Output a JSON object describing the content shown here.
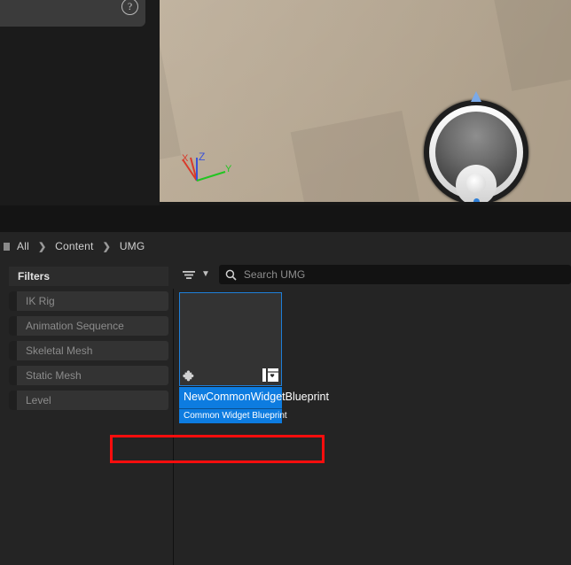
{
  "window": {
    "help_icon": "help-circle-icon"
  },
  "viewport": {
    "gizmo": {
      "x_label": "X",
      "y_label": "Y",
      "z_label": "Z",
      "x_color": "#d93a2b",
      "y_color": "#22c522",
      "z_color": "#3a52d9"
    }
  },
  "breadcrumb": {
    "items": [
      "All",
      "Content",
      "UMG"
    ],
    "separator": "❯"
  },
  "filters": {
    "title": "Filters",
    "items": [
      {
        "label": "IK Rig"
      },
      {
        "label": "Animation Sequence"
      },
      {
        "label": "Skeletal Mesh"
      },
      {
        "label": "Static Mesh"
      },
      {
        "label": "Level"
      }
    ]
  },
  "toolbar": {
    "filter_icon": "filter-icon",
    "dropdown_icon": "chevron-down-icon",
    "search_icon": "search-icon",
    "search_placeholder": "Search UMG",
    "search_value": ""
  },
  "assets": [
    {
      "name": "NewCommonWidgetBlueprint",
      "type": "Common Widget Blueprint",
      "selected": true,
      "blueprint_icon": "puzzle-piece-icon",
      "widget_icon": "umg-widget-icon"
    }
  ],
  "annotation": {
    "color": "#fc0d0d",
    "target": "asset-type-label"
  },
  "colors": {
    "accent_blue": "#0d7ce0",
    "selection_border": "#1f7fd8",
    "panel_bg": "#242424",
    "field_bg": "#121212",
    "annotation_red": "#fc0d0d"
  }
}
